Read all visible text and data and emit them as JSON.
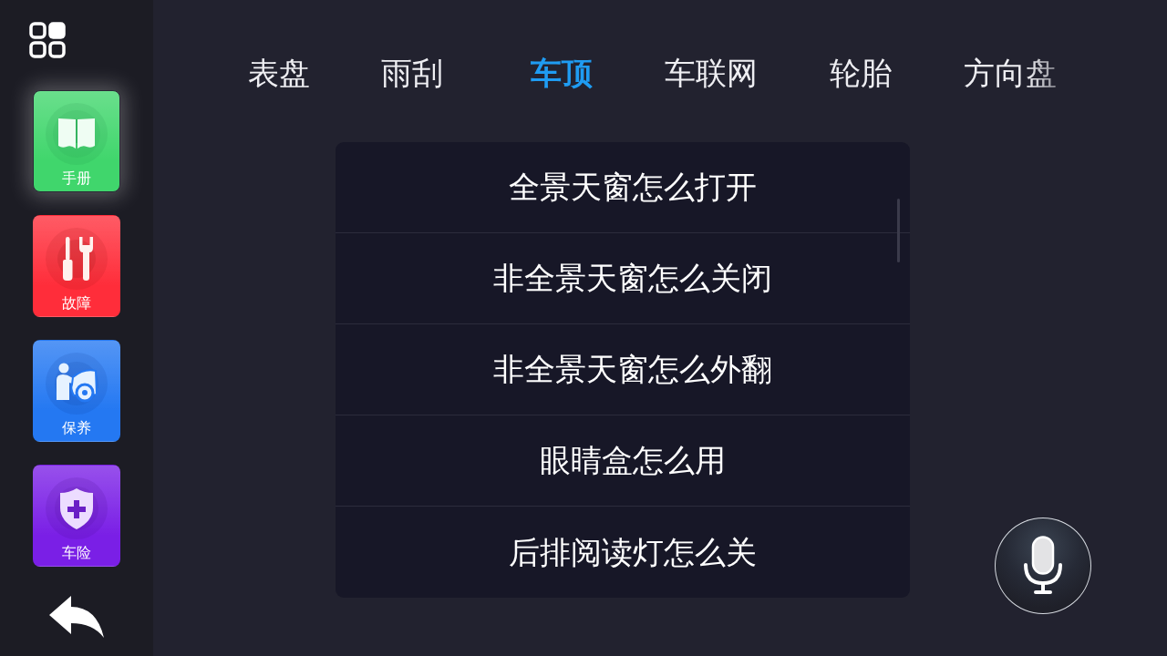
{
  "sidebar": {
    "items": [
      {
        "label": "手册",
        "selected": true,
        "color": "#40d66c"
      },
      {
        "label": "故障",
        "selected": false,
        "color": "#ff2d3a"
      },
      {
        "label": "保养",
        "selected": false,
        "color": "#2478f2"
      },
      {
        "label": "车险",
        "selected": false,
        "color": "#7a1fe6"
      }
    ]
  },
  "tabs": [
    {
      "label": "表盘",
      "selected": false
    },
    {
      "label": "雨刮",
      "selected": false
    },
    {
      "label": "车顶",
      "selected": true
    },
    {
      "label": "车联网",
      "selected": false
    },
    {
      "label": "轮胎",
      "selected": false
    },
    {
      "label": "方向盘",
      "selected": false
    }
  ],
  "questions": [
    "全景天窗怎么打开",
    "非全景天窗怎么关闭",
    "非全景天窗怎么外翻",
    "眼睛盒怎么用",
    "后排阅读灯怎么关"
  ]
}
